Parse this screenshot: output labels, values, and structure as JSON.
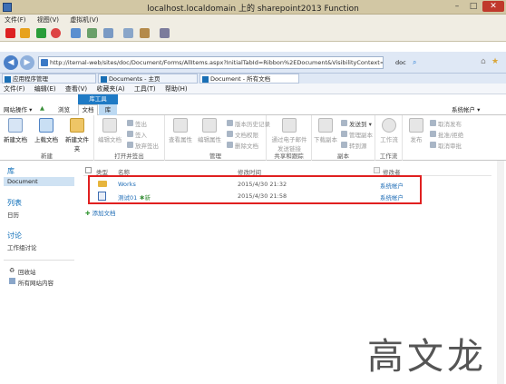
{
  "vm": {
    "title": "localhost.localdomain 上的 sharepoint2013 Function",
    "menu": [
      "文件(F)",
      "视图(V)",
      "虚拟机(V)"
    ]
  },
  "browser": {
    "address": "http://iternal-web/sites/doc/Document/Forms/AllItems.aspx?InitialTabId=Ribbon%2EDocument&VisibilityContext=WSSTabPersistence",
    "address_suffix": "doc",
    "tabs": [
      "应用程序管理",
      "Documents - 主页",
      "Document - 所有文档"
    ],
    "menu": [
      "文件(F)",
      "编辑(E)",
      "查看(V)",
      "收藏夹(A)",
      "工具(T)",
      "帮助(H)"
    ]
  },
  "suite": {
    "site_actions": "网站操作 ▾",
    "browse": "浏览",
    "context_group": "库工具",
    "tab_documents": "文档",
    "tab_library": "库",
    "user": "系统帐户 ▾"
  },
  "ribbon": {
    "new": {
      "new_doc": "新建文档",
      "upload": "上载文档",
      "new_folder": "新建文件夹",
      "label": "新建"
    },
    "open": {
      "edit": "编辑文档",
      "checkout": "签出",
      "checkin": "签入",
      "discard": "放弃签出",
      "label": "打开并签出"
    },
    "manage": {
      "view_props": "查看属性",
      "edit_props": "编辑属性",
      "history": "版本历史记录",
      "permissions": "文档权限",
      "delete": "删除文档",
      "label": "管理"
    },
    "share": {
      "email_link": "通过电子邮件发送链接",
      "label": "共享和跟踪"
    },
    "copies": {
      "download": "下载副本",
      "send_to": "发送到 ▾",
      "manage_copies": "管理副本",
      "goto_source": "转到源",
      "label": "副本"
    },
    "workflow": {
      "workflows": "工作流",
      "label": "工作流"
    },
    "publish": {
      "publish": "发布",
      "unpublish": "取消发布",
      "approve": "批准/拒绝",
      "cancel_approval": "取消审批"
    }
  },
  "leftnav": {
    "library_head": "库",
    "selected": "Document",
    "lists_head": "列表",
    "calendar": "日历",
    "discussion_head": "讨论",
    "team_discussion": "工作组讨论",
    "recycle": "回收站",
    "all_content": "所有网站内容"
  },
  "list": {
    "columns": {
      "type": "类型",
      "name": "名称",
      "modified": "修改时间",
      "modified_by": "修改者"
    },
    "rows": [
      {
        "type": "folder-icon",
        "name": "Works",
        "new_tag": "",
        "modified": "2015/4/30 21:32",
        "modified_by": "系统帐户"
      },
      {
        "type": "document-icon",
        "name": "测试01",
        "new_tag": "新",
        "modified": "2015/4/30 21:58",
        "modified_by": "系统帐户"
      }
    ],
    "add_document": "添加文档"
  },
  "watermark": "高文龙",
  "colors": {
    "accent": "#1e7ac5",
    "link": "#1e6cb6",
    "highlight": "#e02020"
  }
}
